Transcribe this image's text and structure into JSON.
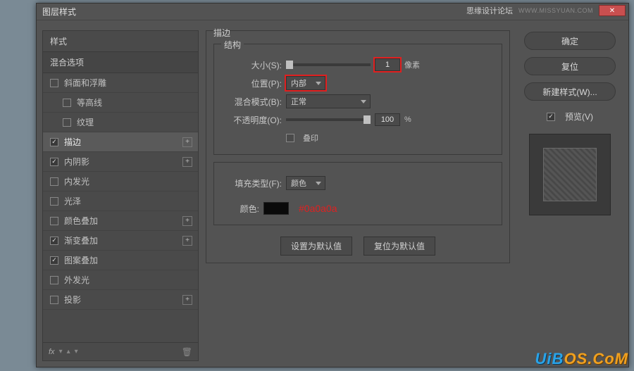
{
  "window": {
    "title": "图层样式",
    "brand": "思缘设计论坛",
    "brand_url": "WWW.MISSYUAN.COM"
  },
  "left": {
    "header": "样式",
    "sub": "混合选项",
    "items": [
      {
        "label": "斜面和浮雕",
        "checked": false,
        "indent": false,
        "plus": false
      },
      {
        "label": "等高线",
        "checked": false,
        "indent": true,
        "plus": false
      },
      {
        "label": "纹理",
        "checked": false,
        "indent": true,
        "plus": false
      },
      {
        "label": "描边",
        "checked": true,
        "indent": false,
        "plus": true,
        "selected": true
      },
      {
        "label": "内阴影",
        "checked": true,
        "indent": false,
        "plus": true
      },
      {
        "label": "内发光",
        "checked": false,
        "indent": false,
        "plus": false
      },
      {
        "label": "光泽",
        "checked": false,
        "indent": false,
        "plus": false
      },
      {
        "label": "颜色叠加",
        "checked": false,
        "indent": false,
        "plus": true
      },
      {
        "label": "渐变叠加",
        "checked": true,
        "indent": false,
        "plus": true
      },
      {
        "label": "图案叠加",
        "checked": true,
        "indent": false,
        "plus": false
      },
      {
        "label": "外发光",
        "checked": false,
        "indent": false,
        "plus": false
      },
      {
        "label": "投影",
        "checked": false,
        "indent": false,
        "plus": true
      }
    ],
    "fx": "fx"
  },
  "mid": {
    "section": "描边",
    "structure": "结构",
    "size_label": "大小(S):",
    "size_value": "1",
    "size_unit": "像素",
    "position_label": "位置(P):",
    "position_value": "内部",
    "blend_label": "混合模式(B):",
    "blend_value": "正常",
    "opacity_label": "不透明度(O):",
    "opacity_value": "100",
    "opacity_unit": "%",
    "overprint_label": "叠印",
    "filltype_label": "填充类型(F):",
    "filltype_value": "颜色",
    "color_label": "颜色:",
    "color_hex": "#0a0a0a",
    "btn_default": "设置为默认值",
    "btn_reset": "复位为默认值"
  },
  "right": {
    "ok": "确定",
    "cancel": "复位",
    "newstyle": "新建样式(W)...",
    "preview": "预览(V)"
  },
  "watermark": {
    "a": "UiB",
    "b": "OS.CoM"
  }
}
